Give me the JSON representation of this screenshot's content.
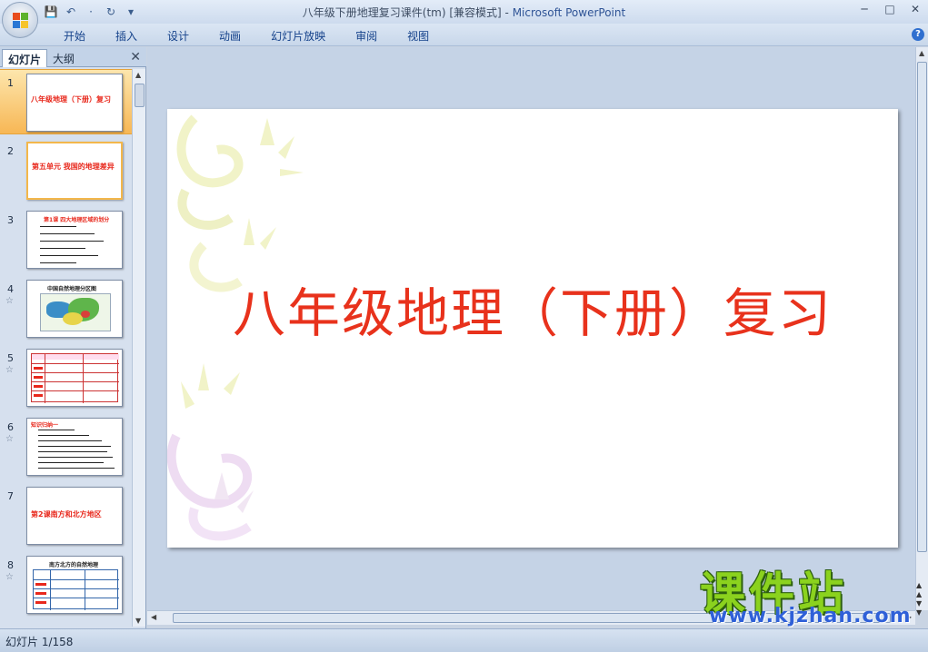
{
  "window": {
    "doc_title": "八年级下册地理复习课件(tm) [兼容模式]",
    "separator": " - ",
    "app_name": "Microsoft PowerPoint",
    "min_label": "─",
    "max_label": "□",
    "close_label": "✕"
  },
  "qat": {
    "save_icon": "💾",
    "undo_icon": "↶",
    "sep": "·",
    "redo_icon": "↻",
    "more_icon": "▾"
  },
  "ribbon": {
    "tabs": [
      "开始",
      "插入",
      "设计",
      "动画",
      "幻灯片放映",
      "审阅",
      "视图"
    ],
    "help_label": "?"
  },
  "left_panel": {
    "tab_slides": "幻灯片",
    "tab_outline": "大纲",
    "close_label": "✕",
    "thumbnails": [
      {
        "num": "1",
        "title": "八年级地理（下册）复习",
        "star": ""
      },
      {
        "num": "2",
        "title": "第五单元 我国的地理差异",
        "star": ""
      },
      {
        "num": "3",
        "title": "第1课 四大地理区域的划分",
        "star": ""
      },
      {
        "num": "4",
        "title": "中国自然地理分区图",
        "star": "☆"
      },
      {
        "num": "5",
        "title": "",
        "star": "☆"
      },
      {
        "num": "6",
        "title": "知识归纳一",
        "star": "☆"
      },
      {
        "num": "7",
        "title": "第2课南方和北方地区",
        "star": ""
      },
      {
        "num": "8",
        "title": "南方北方的自然地理",
        "star": "☆"
      }
    ]
  },
  "slide": {
    "title": "八年级地理（下册）复习"
  },
  "status": {
    "slide_label": "幻灯片 1/158"
  },
  "watermark": {
    "brand": "课件站",
    "url": "www.kjzhan.com"
  },
  "colors": {
    "accent_red": "#e8321c",
    "brand_green": "#8bd21e",
    "brand_blue": "#2f60d8"
  }
}
